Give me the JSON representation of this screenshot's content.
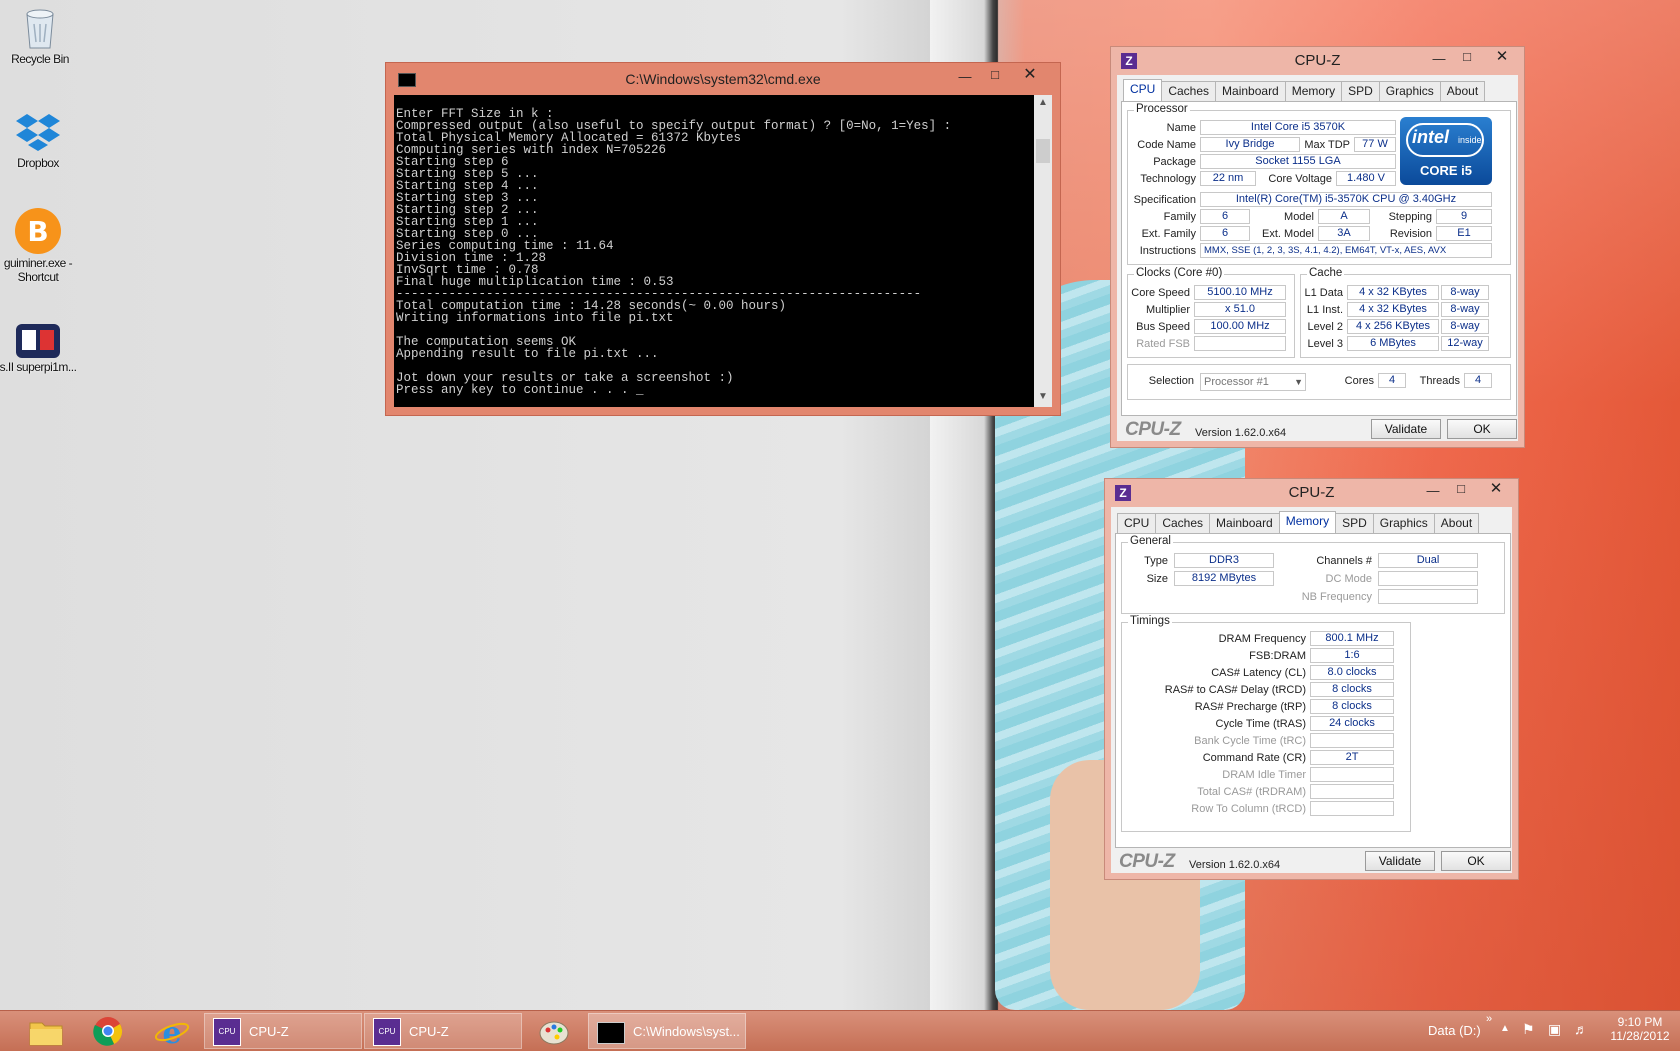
{
  "desktop": {
    "icons": [
      {
        "label": "Recycle Bin",
        "icon": "recycle-bin-icon"
      },
      {
        "label": "Dropbox",
        "icon": "dropbox-icon"
      },
      {
        "label": "guiminer.exe - Shortcut",
        "icon": "bitcoin-icon"
      },
      {
        "label": "s.II superpi1m...",
        "icon": "superpi-icon"
      }
    ]
  },
  "cmd": {
    "title": "C:\\Windows\\system32\\cmd.exe",
    "lines": [
      "Enter FFT Size in k :",
      "Compressed output (also useful to specify output format) ? [0=No, 1=Yes] :",
      "Total Physical Memory Allocated = 61372 Kbytes",
      "Computing series with index N=705226",
      "Starting step 6",
      "Starting step 5 ...",
      "Starting step 4 ...",
      "Starting step 3 ...",
      "Starting step 2 ...",
      "Starting step 1 ...",
      "Starting step 0 ...",
      "Series computing time : 11.64",
      "Division time : 1.28",
      "InvSqrt time : 0.78",
      "Final huge multiplication time : 0.53",
      "----------------------------------------------------------------------",
      "Total computation time : 14.28 seconds(~ 0.00 hours)",
      "Writing informations into file pi.txt",
      "",
      "The computation seems OK",
      "Appending result to file pi.txt ...",
      "",
      "Jot down your results or take a screenshot :)",
      "Press any key to continue . . . _"
    ]
  },
  "cpuz_cpu": {
    "title": "CPU-Z",
    "tabs": [
      "CPU",
      "Caches",
      "Mainboard",
      "Memory",
      "SPD",
      "Graphics",
      "About"
    ],
    "active_tab": "CPU",
    "processor_group": "Processor",
    "name_label": "Name",
    "name": "Intel Core i5 3570K",
    "codename_label": "Code Name",
    "codename": "Ivy Bridge",
    "maxtdp_label": "Max TDP",
    "maxtdp": "77 W",
    "package_label": "Package",
    "package": "Socket 1155 LGA",
    "technology_label": "Technology",
    "technology": "22 nm",
    "corevoltage_label": "Core Voltage",
    "corevoltage": "1.480 V",
    "spec_label": "Specification",
    "spec": "Intel(R) Core(TM) i5-3570K CPU @ 3.40GHz",
    "family_label": "Family",
    "family": "6",
    "model_label": "Model",
    "model": "A",
    "stepping_label": "Stepping",
    "stepping": "9",
    "extfamily_label": "Ext. Family",
    "extfamily": "6",
    "extmodel_label": "Ext. Model",
    "extmodel": "3A",
    "revision_label": "Revision",
    "revision": "E1",
    "instructions_label": "Instructions",
    "instructions": "MMX, SSE (1, 2, 3, 3S, 4.1, 4.2), EM64T, VT-x, AES, AVX",
    "intel_logo_text": "intel",
    "intel_inside_text": "inside",
    "intel_core_text": "CORE i5",
    "clocks_group": "Clocks (Core #0)",
    "corespeed_label": "Core Speed",
    "corespeed": "5100.10 MHz",
    "multiplier_label": "Multiplier",
    "multiplier": "x 51.0",
    "busspeed_label": "Bus Speed",
    "busspeed": "100.00 MHz",
    "ratedfsb_label": "Rated FSB",
    "ratedfsb": "",
    "cache_group": "Cache",
    "l1data_label": "L1 Data",
    "l1data": "4 x 32 KBytes",
    "l1data_way": "8-way",
    "l1inst_label": "L1 Inst.",
    "l1inst": "4 x 32 KBytes",
    "l1inst_way": "8-way",
    "level2_label": "Level 2",
    "level2": "4 x 256 KBytes",
    "level2_way": "8-way",
    "level3_label": "Level 3",
    "level3": "6 MBytes",
    "level3_way": "12-way",
    "selection_label": "Selection",
    "selection": "Processor #1",
    "cores_label": "Cores",
    "cores": "4",
    "threads_label": "Threads",
    "threads": "4",
    "brand": "CPU-Z",
    "version": "Version 1.62.0.x64",
    "validate": "Validate",
    "ok": "OK"
  },
  "cpuz_mem": {
    "title": "CPU-Z",
    "tabs": [
      "CPU",
      "Caches",
      "Mainboard",
      "Memory",
      "SPD",
      "Graphics",
      "About"
    ],
    "active_tab": "Memory",
    "general_group": "General",
    "type_label": "Type",
    "type": "DDR3",
    "size_label": "Size",
    "size": "8192 MBytes",
    "channels_label": "Channels #",
    "channels": "Dual",
    "dcmode_label": "DC Mode",
    "dcmode": "",
    "nbfreq_label": "NB Frequency",
    "nbfreq": "",
    "timings_group": "Timings",
    "timings": [
      {
        "label": "DRAM Frequency",
        "value": "800.1 MHz",
        "dim": false
      },
      {
        "label": "FSB:DRAM",
        "value": "1:6",
        "dim": false
      },
      {
        "label": "CAS# Latency (CL)",
        "value": "8.0 clocks",
        "dim": false
      },
      {
        "label": "RAS# to CAS# Delay (tRCD)",
        "value": "8 clocks",
        "dim": false
      },
      {
        "label": "RAS# Precharge (tRP)",
        "value": "8 clocks",
        "dim": false
      },
      {
        "label": "Cycle Time (tRAS)",
        "value": "24 clocks",
        "dim": false
      },
      {
        "label": "Bank Cycle Time (tRC)",
        "value": "",
        "dim": true
      },
      {
        "label": "Command Rate (CR)",
        "value": "2T",
        "dim": false
      },
      {
        "label": "DRAM Idle Timer",
        "value": "",
        "dim": true
      },
      {
        "label": "Total CAS# (tRDRAM)",
        "value": "",
        "dim": true
      },
      {
        "label": "Row To Column (tRCD)",
        "value": "",
        "dim": true
      }
    ],
    "brand": "CPU-Z",
    "version": "Version 1.62.0.x64",
    "validate": "Validate",
    "ok": "OK"
  },
  "taskbar": {
    "apps": [
      {
        "label": "CPU-Z",
        "icon": "cpuz-icon"
      },
      {
        "label": "CPU-Z",
        "icon": "cpuz-icon"
      },
      {
        "label": "C:\\Windows\\syst...",
        "icon": "cmd-icon"
      }
    ],
    "drive_label": "Data (D:)",
    "time": "9:10 PM",
    "date": "11/28/2012"
  }
}
